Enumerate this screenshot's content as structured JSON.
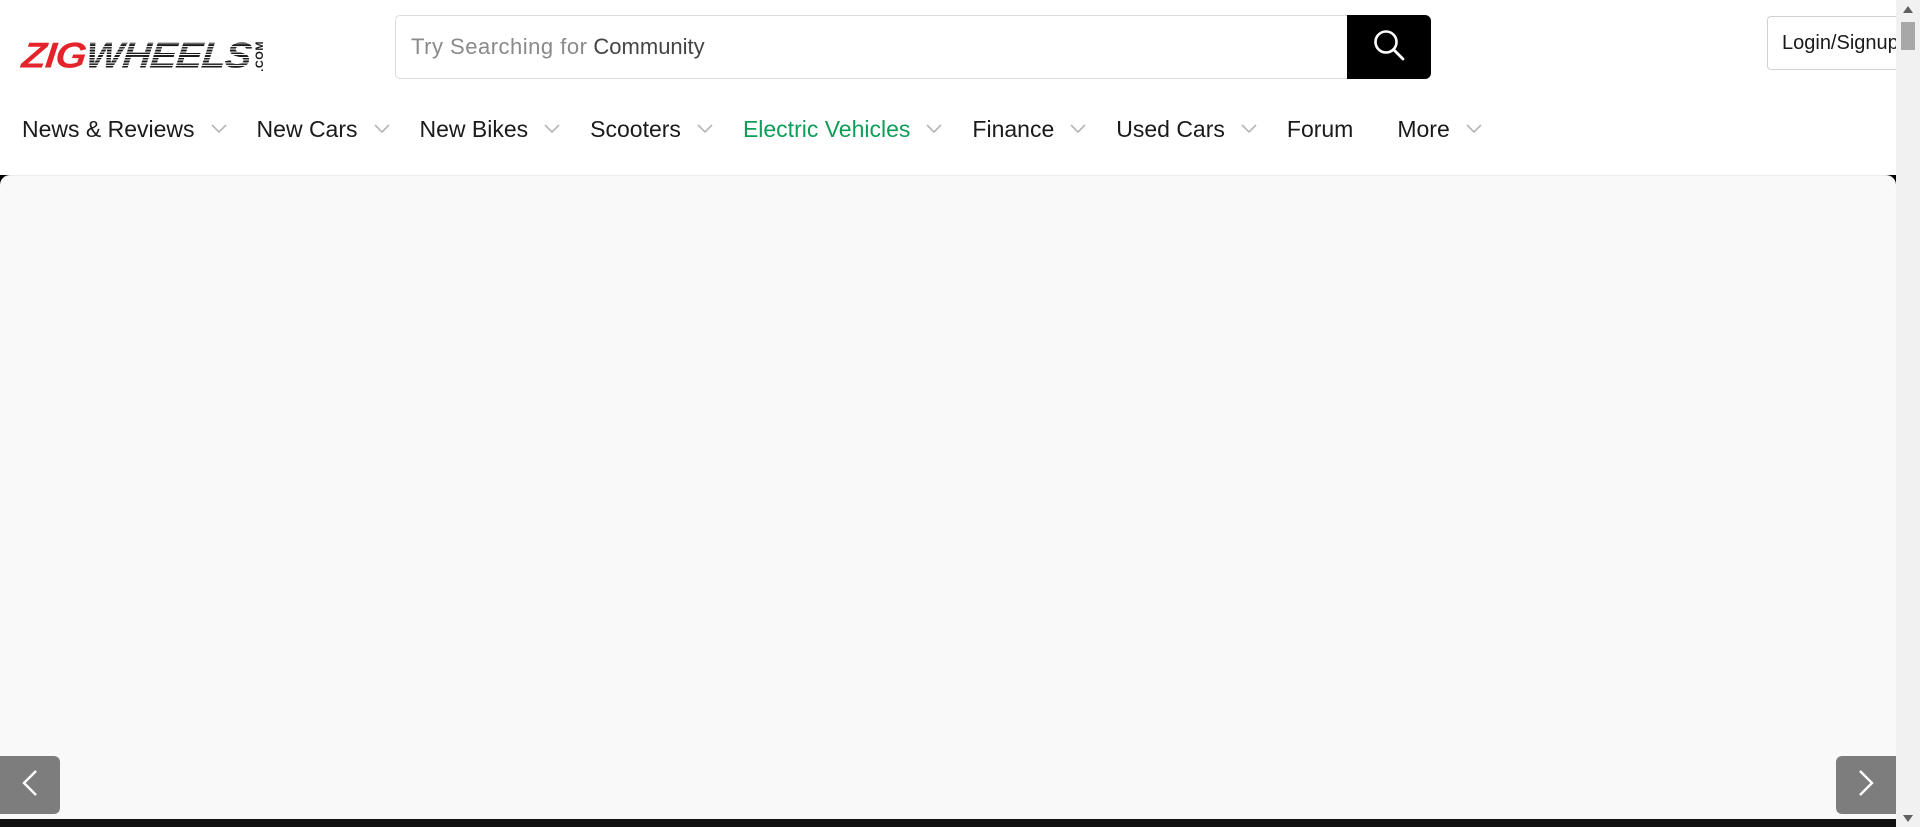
{
  "header": {
    "logo": {
      "part1": "ZIG",
      "part2": "WHEELS",
      "suffix": ".COM"
    },
    "search": {
      "prefix": "Try Searching for",
      "value": "Community",
      "button_icon": "search-icon"
    },
    "login_label": "Login/Signup"
  },
  "nav": {
    "items": [
      {
        "label": "News & Reviews",
        "has_dropdown": true
      },
      {
        "label": "New Cars",
        "has_dropdown": true
      },
      {
        "label": "New Bikes",
        "has_dropdown": true
      },
      {
        "label": "Scooters",
        "has_dropdown": true
      },
      {
        "label": "Electric Vehicles",
        "has_dropdown": true,
        "active": true
      },
      {
        "label": "Finance",
        "has_dropdown": true
      },
      {
        "label": "Used Cars",
        "has_dropdown": true
      },
      {
        "label": "Forum",
        "has_dropdown": false
      },
      {
        "label": "More",
        "has_dropdown": true
      }
    ]
  },
  "carousel": {
    "prev_icon": "chevron-left-icon",
    "next_icon": "chevron-right-icon"
  },
  "colors": {
    "brand_red": "#e4232b",
    "active_green": "#0f9d58",
    "search_button": "#000000",
    "carousel_button": "#7d7d7d"
  }
}
